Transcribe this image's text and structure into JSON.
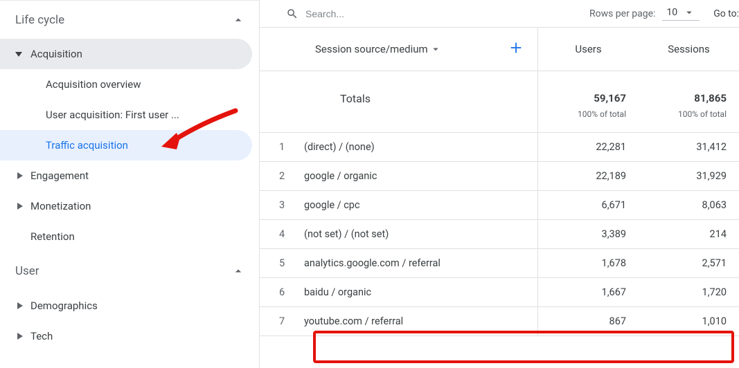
{
  "sidebar": {
    "sections": [
      {
        "heading": "Life cycle",
        "expanded": true,
        "groups": [
          {
            "label": "Acquisition",
            "expanded": true,
            "items": [
              {
                "label": "Acquisition overview",
                "active": false
              },
              {
                "label": "User acquisition: First user ...",
                "active": false
              },
              {
                "label": "Traffic acquisition",
                "active": true
              }
            ]
          },
          {
            "label": "Engagement",
            "expanded": false
          },
          {
            "label": "Monetization",
            "expanded": false
          },
          {
            "label": "Retention",
            "expanded": false,
            "leaf": true
          }
        ]
      },
      {
        "heading": "User",
        "expanded": true,
        "groups": [
          {
            "label": "Demographics",
            "expanded": false
          },
          {
            "label": "Tech",
            "expanded": false
          }
        ]
      }
    ]
  },
  "toolbar": {
    "search_placeholder": "Search...",
    "rows_label": "Rows per page:",
    "rows_value": "10",
    "goto_label": "Go to:"
  },
  "table": {
    "dimension": "Session source/medium",
    "metrics": [
      "Users",
      "Sessions"
    ],
    "totals": {
      "label": "Totals",
      "values": [
        "59,167",
        "81,865"
      ],
      "pct": "100% of total"
    },
    "rows": [
      {
        "idx": "1",
        "name": "(direct) / (none)",
        "users": "22,281",
        "sessions": "31,412"
      },
      {
        "idx": "2",
        "name": "google / organic",
        "users": "22,189",
        "sessions": "31,929"
      },
      {
        "idx": "3",
        "name": "google / cpc",
        "users": "6,671",
        "sessions": "8,063"
      },
      {
        "idx": "4",
        "name": "(not set) / (not set)",
        "users": "3,389",
        "sessions": "214"
      },
      {
        "idx": "5",
        "name": "analytics.google.com / referral",
        "users": "1,678",
        "sessions": "2,571"
      },
      {
        "idx": "6",
        "name": "baidu / organic",
        "users": "1,667",
        "sessions": "1,720"
      },
      {
        "idx": "7",
        "name": "youtube.com / referral",
        "users": "867",
        "sessions": "1,010",
        "highlight": true
      }
    ]
  },
  "annotations": {
    "highlight_color": "#e4130b"
  }
}
